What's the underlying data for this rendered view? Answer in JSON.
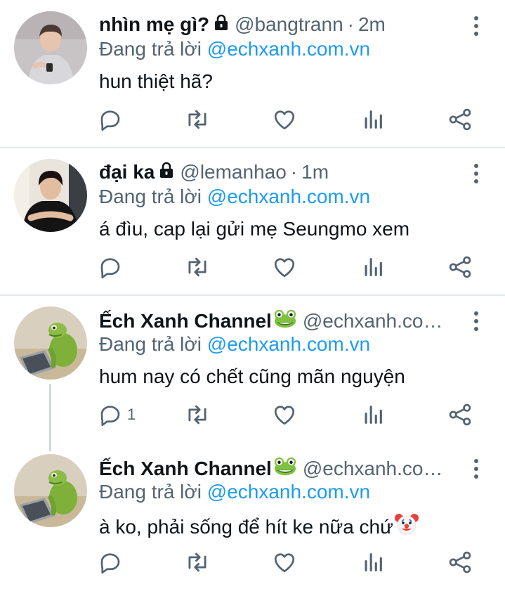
{
  "tweets": [
    {
      "display_name": "nhìn mẹ gì?",
      "handle": "@bangtrann",
      "separator": "·",
      "time": "2m",
      "reply_prefix": "Đang trả lời",
      "reply_to": "@echxanh.com.vn",
      "text": "hun thiệt hã?",
      "reply_count": "",
      "locked": true
    },
    {
      "display_name": "đại ka",
      "handle": "@lemanhao",
      "separator": "·",
      "time": "1m",
      "reply_prefix": "Đang trả lời",
      "reply_to": "@echxanh.com.vn",
      "text": "á đìu, cap lại gửi mẹ Seungmo xem",
      "reply_count": "",
      "locked": true
    },
    {
      "display_name": "Ếch Xanh Channel",
      "handle": "@echxanh.co…",
      "reply_prefix": "Đang trả lời",
      "reply_to": "@echxanh.com.vn",
      "text": "hum nay có chết cũng mãn nguyện",
      "reply_count": "1",
      "name_emoji": "frog-icon"
    },
    {
      "display_name": "Ếch Xanh Channel",
      "handle": "@echxanh.co…",
      "reply_prefix": "Đang trả lời",
      "reply_to": "@echxanh.com.vn",
      "text": "à ko, phải sống để hít ke nữa chứ",
      "reply_count": "",
      "name_emoji": "frog-icon",
      "text_emoji": "clown-face-icon"
    }
  ],
  "icons": {
    "reply": "reply-icon",
    "retweet": "retweet-icon",
    "like": "like-icon",
    "analytics": "analytics-icon",
    "share": "share-icon",
    "more": "more-vertical-icon",
    "lock": "lock-icon"
  },
  "colors": {
    "link": "#1d9bf0",
    "secondary_text": "#536471",
    "divider": "#e1e8ed",
    "thread_line": "#cfd9de",
    "frog_green": "#7fc242"
  }
}
